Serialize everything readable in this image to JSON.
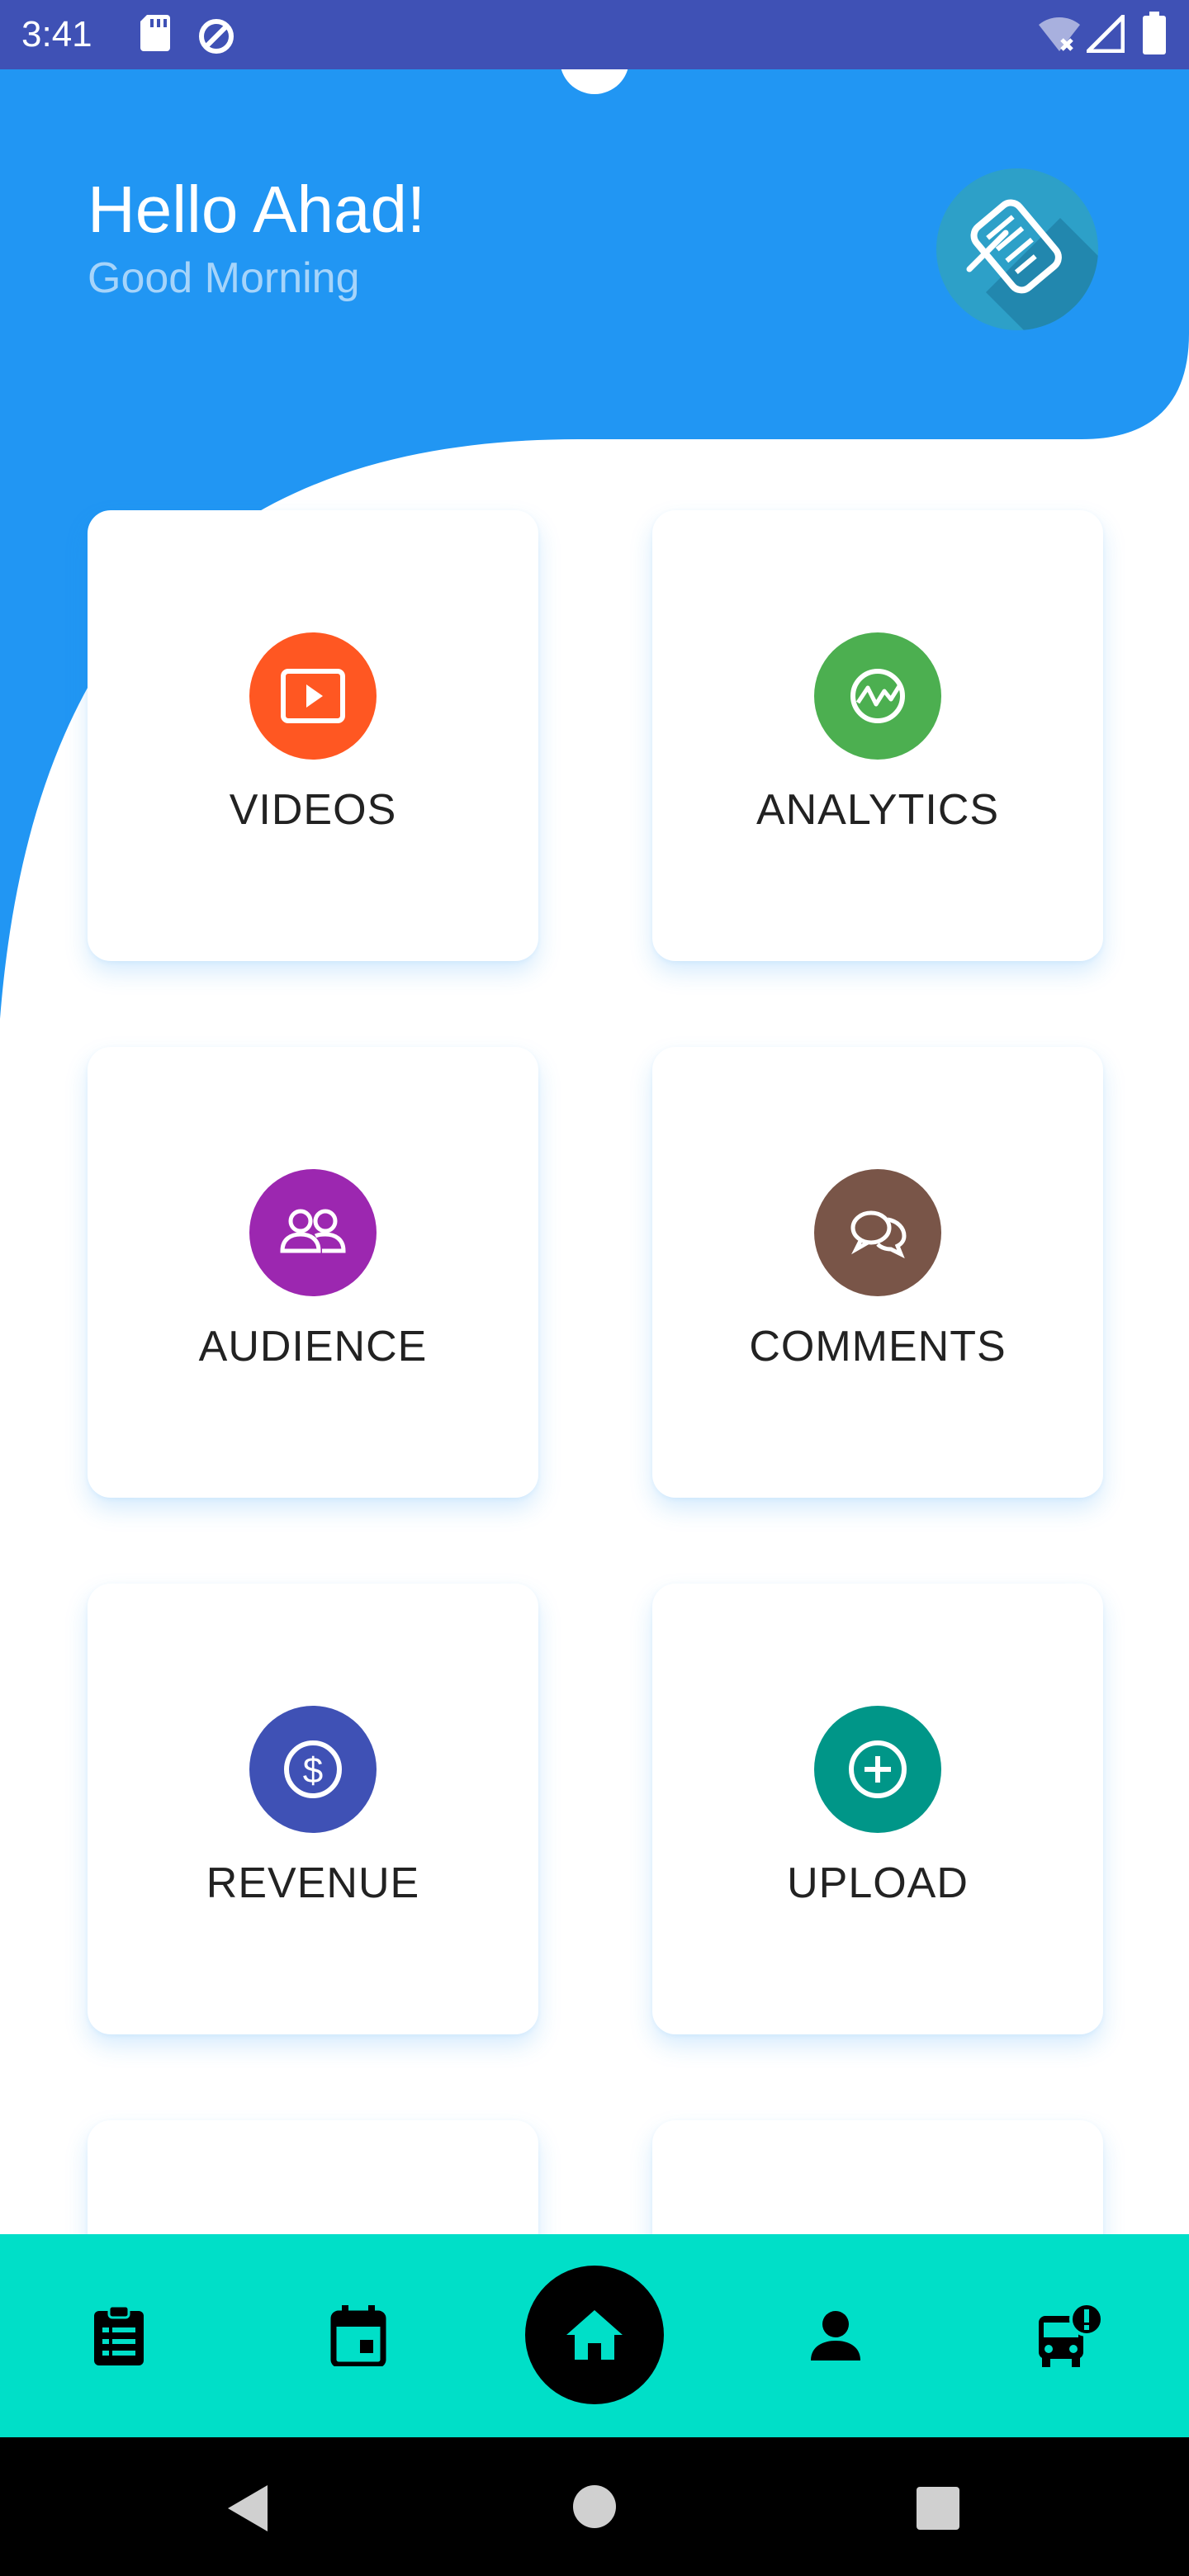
{
  "status_bar": {
    "time": "3:41",
    "icons": [
      "sd-card-icon",
      "sync-icon",
      "wifi-off-icon",
      "signal-icon",
      "battery-icon"
    ],
    "color": "#3f51b5"
  },
  "header": {
    "greeting": "Hello Ahad!",
    "subtitle": "Good Morning",
    "logo_icon": "notebook-pencil-icon",
    "color": "#2196f3"
  },
  "cards": [
    {
      "label": "VIDEOS",
      "icon": "video-play-icon",
      "color": "#ff5722"
    },
    {
      "label": "ANALYTICS",
      "icon": "analytics-chart-icon",
      "color": "#4caf50"
    },
    {
      "label": "AUDIENCE",
      "icon": "people-icon",
      "color": "#9c27b0"
    },
    {
      "label": "COMMENTS",
      "icon": "chat-bubbles-icon",
      "color": "#795548"
    },
    {
      "label": "REVENUE",
      "icon": "dollar-icon",
      "color": "#3f51b5"
    },
    {
      "label": "UPLOAD",
      "icon": "plus-circle-icon",
      "color": "#009688"
    }
  ],
  "bottom_nav": {
    "items": [
      {
        "icon": "clipboard-icon"
      },
      {
        "icon": "calendar-icon"
      },
      {
        "icon": "home-icon",
        "active": true
      },
      {
        "icon": "person-icon"
      },
      {
        "icon": "bus-alert-icon"
      }
    ],
    "color": "#00dfc8"
  },
  "system_nav": [
    "back-icon",
    "home-circle-icon",
    "recents-icon"
  ]
}
